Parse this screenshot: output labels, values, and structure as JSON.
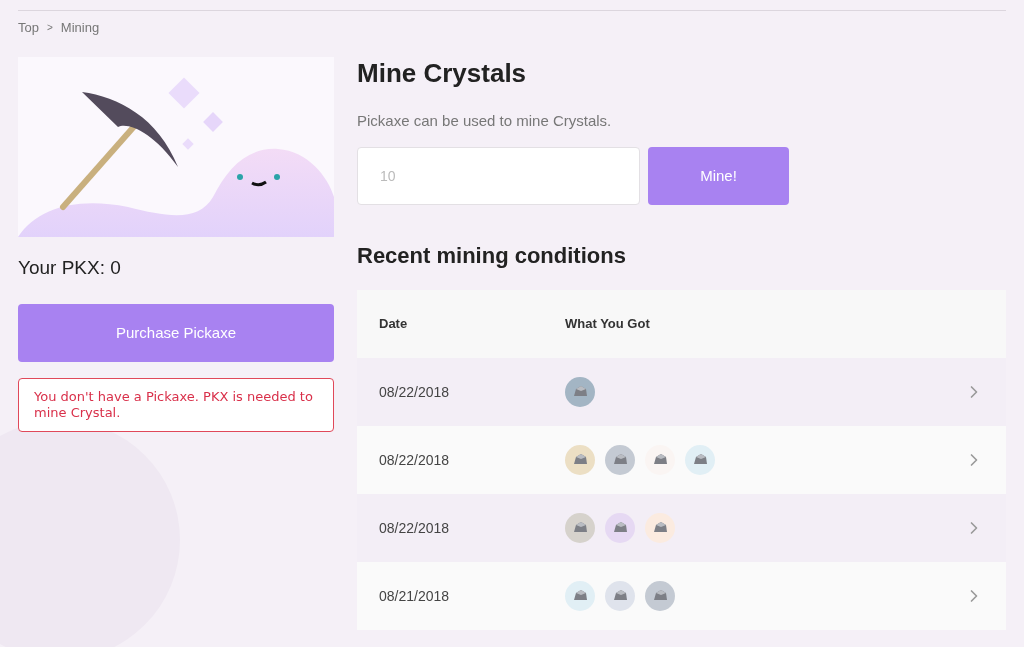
{
  "breadcrumb": [
    "Top",
    "Mining"
  ],
  "breadcrumb_separator": ">",
  "pkx": {
    "label": "Your PKX: 0"
  },
  "purchase_button": "Purchase Pickaxe",
  "alert": "You don't have a Pickaxe. PKX is needed to mine Crystal.",
  "title": "Mine Crystals",
  "description": "Pickaxe can be used to mine Crystals.",
  "amount_field": {
    "placeholder": "10"
  },
  "mine_button": "Mine!",
  "history": {
    "title": "Recent mining conditions",
    "columns": [
      "Date",
      "What You Got"
    ],
    "rows": [
      {
        "date": "08/22/2018",
        "items": [
          {
            "color": "#a3b5c4"
          }
        ]
      },
      {
        "date": "08/22/2018",
        "items": [
          {
            "color": "#ecdfc4"
          },
          {
            "color": "#c4cad3"
          },
          {
            "color": "#faf5f3"
          },
          {
            "color": "#e1eff5"
          }
        ]
      },
      {
        "date": "08/22/2018",
        "items": [
          {
            "color": "#d6d2cc"
          },
          {
            "color": "#e6d9f3"
          },
          {
            "color": "#fbebe0"
          }
        ]
      },
      {
        "date": "08/21/2018",
        "items": [
          {
            "color": "#e1eff5"
          },
          {
            "color": "#dfe3ec"
          },
          {
            "color": "#c4cad3"
          }
        ]
      }
    ]
  }
}
